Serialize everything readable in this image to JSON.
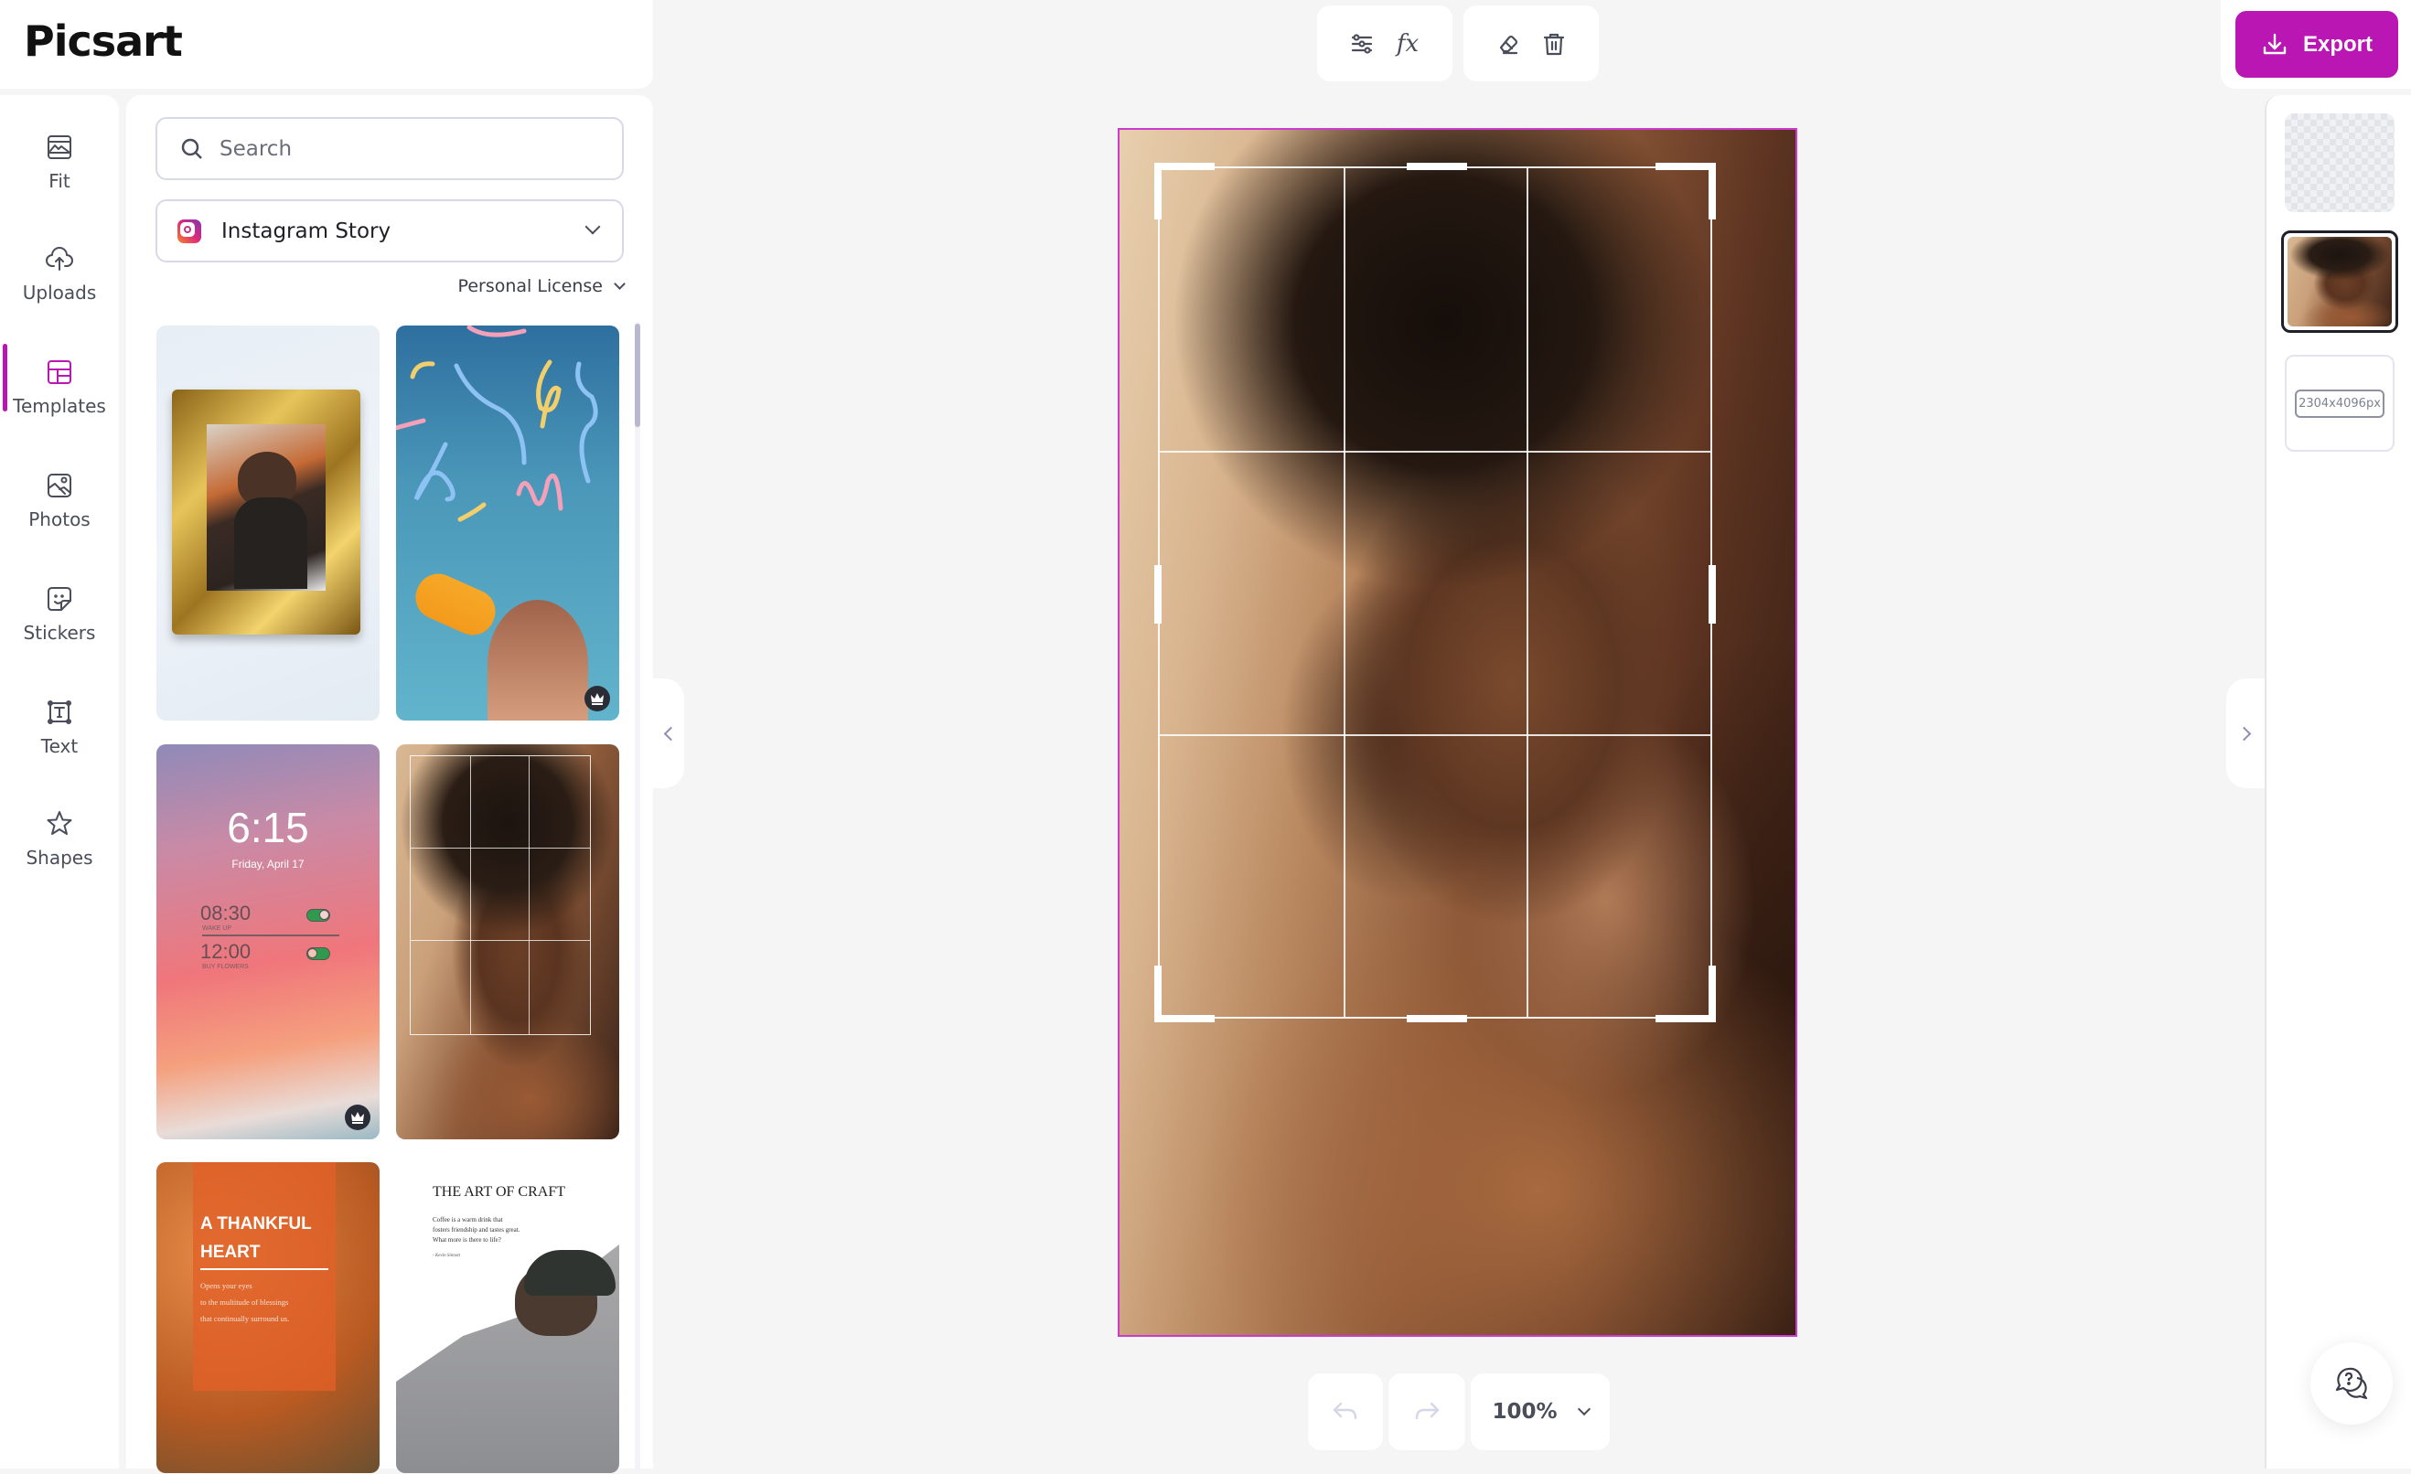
{
  "app": {
    "brand": "Picsart"
  },
  "sidebar": {
    "active": "Templates",
    "items": [
      {
        "label": "Fit",
        "icon": "image-fit-icon"
      },
      {
        "label": "Uploads",
        "icon": "cloud-upload-icon"
      },
      {
        "label": "Templates",
        "icon": "templates-layout-icon"
      },
      {
        "label": "Photos",
        "icon": "photo-icon"
      },
      {
        "label": "Stickers",
        "icon": "sticker-icon"
      },
      {
        "label": "Text",
        "icon": "text-box-icon"
      },
      {
        "label": "Shapes",
        "icon": "star-icon"
      }
    ]
  },
  "templates_panel": {
    "search": {
      "placeholder": "Search",
      "value": ""
    },
    "format": {
      "selected": "Instagram Story",
      "icon": "instagram-icon"
    },
    "license": {
      "selected": "Personal License"
    },
    "templates": [
      {
        "name": "Gold frame portrait",
        "premium": false
      },
      {
        "name": "Confetti drink",
        "premium": true
      },
      {
        "name": "Lock screen alarms",
        "premium": true,
        "clock": "6:15",
        "date": "Friday, April 17",
        "alarms": [
          {
            "time": "08:30",
            "label": "WAKE UP",
            "on": true
          },
          {
            "time": "12:00",
            "label": "BUY FLOWERS",
            "on": true
          }
        ]
      },
      {
        "name": "Portrait crop",
        "premium": false
      },
      {
        "name": "Thankful heart",
        "premium": false,
        "title": "A THANKFUL HEART",
        "body": [
          "Opens your eyes",
          "to the multitude of blessings",
          "that continually surround us."
        ]
      },
      {
        "name": "Art of craft",
        "premium": false,
        "title": "THE ART OF CRAFT",
        "body": [
          "Coffee is a warm drink that",
          "fosters friendship and tastes great.",
          "What more is there to life?"
        ],
        "author": "- Kevin Sinnott"
      }
    ]
  },
  "toolbar": {
    "adjust_icon": "sliders-icon",
    "fx_label": "fx",
    "eraser_icon": "eraser-icon",
    "delete_icon": "trash-icon",
    "export_label": "Export"
  },
  "layers": {
    "items": [
      {
        "type": "background",
        "icon": "transparent-checkerboard"
      },
      {
        "type": "photo",
        "selected": true
      },
      {
        "type": "canvas-size",
        "label": "2304x4096px"
      }
    ]
  },
  "canvas": {
    "crop_grid": "3x3"
  },
  "bottom_bar": {
    "undo_enabled": false,
    "redo_enabled": false,
    "zoom": "100%"
  },
  "colors": {
    "accent": "#b916b3",
    "canvas_border": "#cc3bd0",
    "background": "#f5f5f5"
  }
}
